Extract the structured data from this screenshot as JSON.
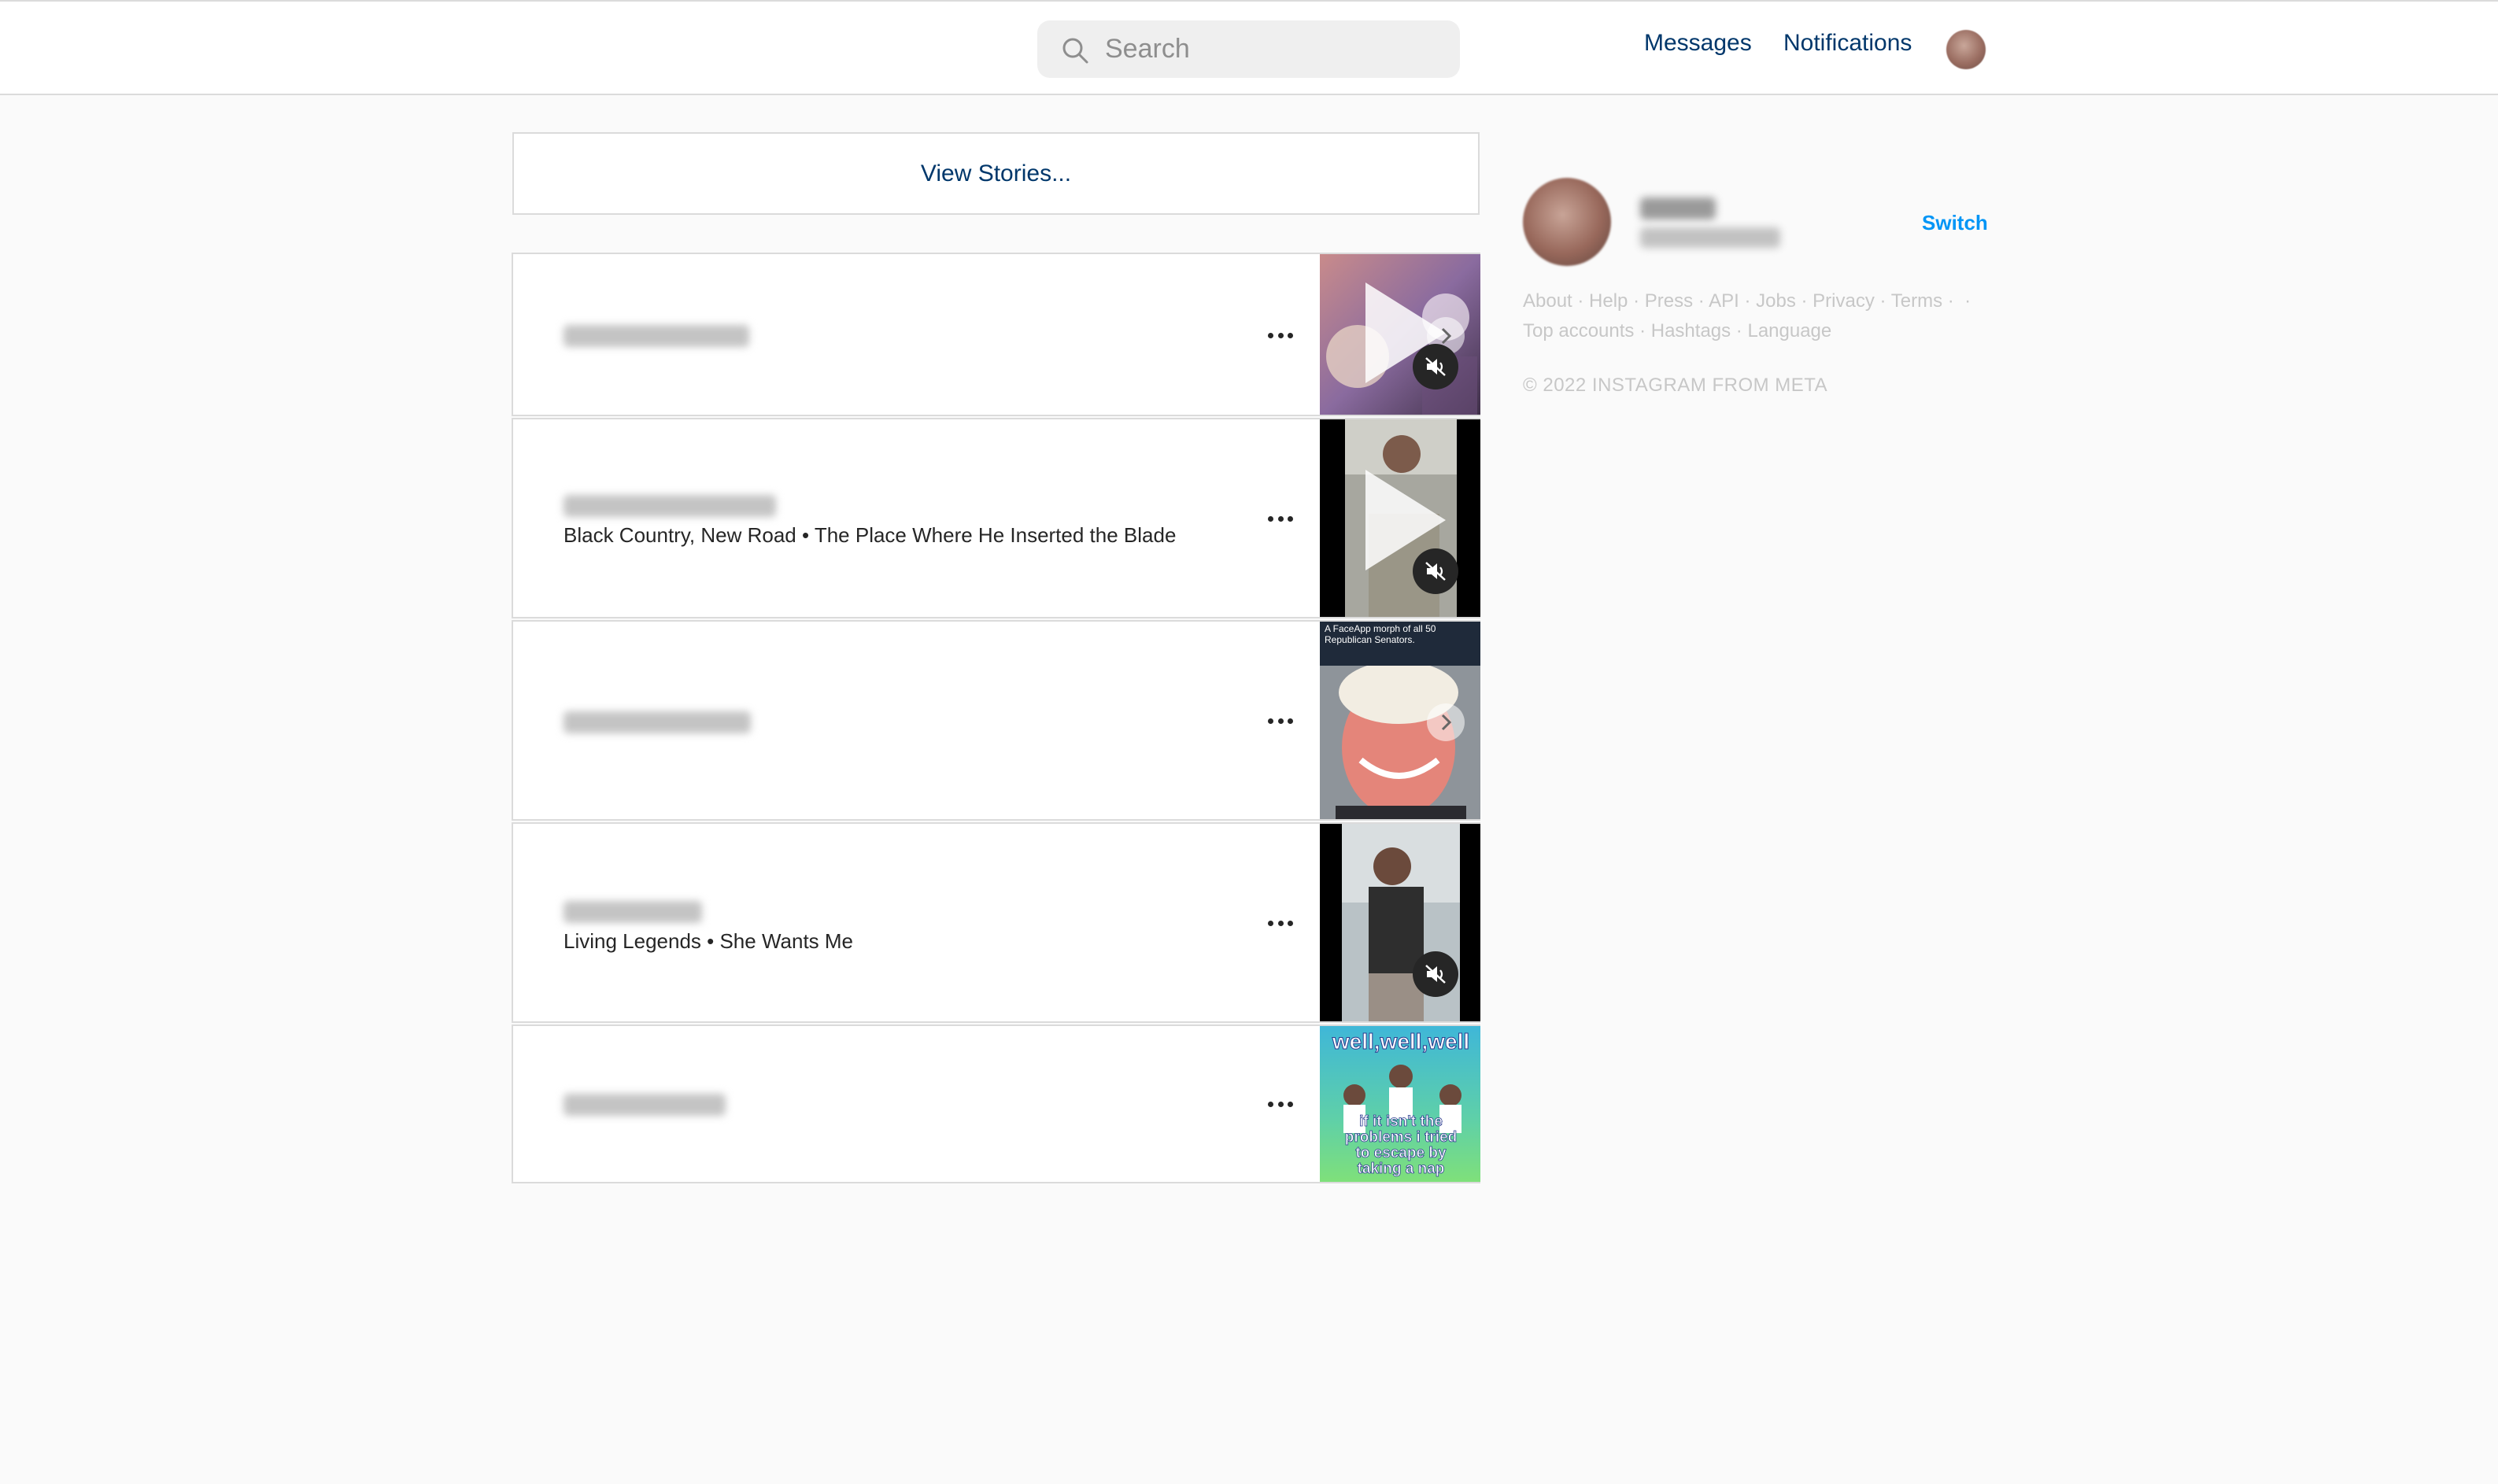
{
  "header": {
    "search_placeholder": "Search",
    "messages_label": "Messages",
    "notifications_label": "Notifications"
  },
  "stories": {
    "label": "View Stories..."
  },
  "posts": [
    {
      "caption": "",
      "media": "video",
      "has_next_arrow": true
    },
    {
      "caption": "Black Country, New Road • The Place Where He Inserted the Blade",
      "media": "video",
      "has_next_arrow": false
    },
    {
      "caption": "",
      "media": "image",
      "has_next_arrow": true,
      "thumb_text": [
        "A FaceApp morph of all 50",
        "Republican Senators."
      ]
    },
    {
      "caption": "Living Legends • She Wants Me",
      "media": "video",
      "has_next_arrow": false
    },
    {
      "caption": "",
      "media": "image",
      "has_next_arrow": false,
      "thumb_text": [
        "well,well,well",
        "if it isn't the",
        "problems i tried",
        "to escape by",
        "taking a nap"
      ]
    }
  ],
  "sidebar": {
    "switch_label": "Switch",
    "footer_links": [
      "About",
      "Help",
      "Press",
      "API",
      "Jobs",
      "Privacy",
      "Terms",
      "Top accounts",
      "Hashtags",
      "Language"
    ],
    "copyright": "© 2022 INSTAGRAM FROM META"
  },
  "colors": {
    "link": "#00376b",
    "accent": "#0095f6",
    "muted": "#c7c7c7",
    "border": "#dbdbdb"
  },
  "icons": [
    "search-icon",
    "more-icon",
    "mute-icon",
    "play-icon",
    "chevron-right-icon"
  ]
}
